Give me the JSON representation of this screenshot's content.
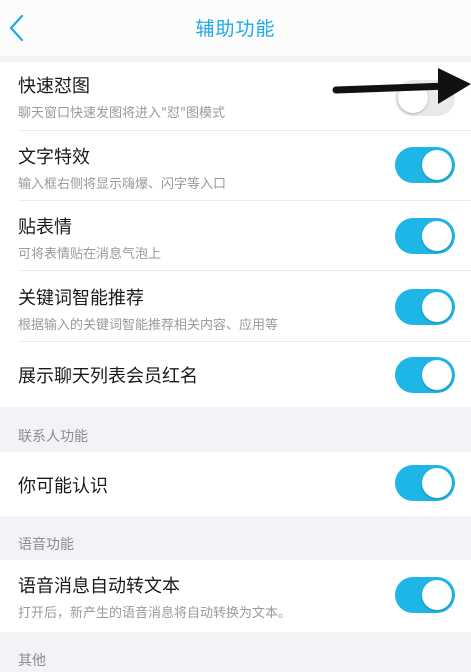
{
  "header": {
    "title": "辅助功能",
    "back_icon": "chevron-left-icon"
  },
  "accent": "#1eb6e6",
  "rows_main": [
    {
      "label": "快速怼图",
      "sub": "聊天窗口快速发图将进入\"怼\"图模式",
      "on": false
    },
    {
      "label": "文字特效",
      "sub": "输入框右侧将显示嗨爆、闪字等入口",
      "on": true
    },
    {
      "label": "贴表情",
      "sub": "可将表情贴在消息气泡上",
      "on": true
    },
    {
      "label": "关键词智能推荐",
      "sub": "根据输入的关键词智能推荐相关内容、应用等",
      "on": true
    },
    {
      "label": "展示聊天列表会员红名",
      "on": true
    }
  ],
  "sections": {
    "contacts": {
      "title": "联系人功能",
      "rows": [
        {
          "label": "你可能认识",
          "on": true
        }
      ]
    },
    "voice": {
      "title": "语音功能",
      "rows": [
        {
          "label": "语音消息自动转文本",
          "sub": "打开后，新产生的语音消息将自动转换为文本。",
          "on": true
        }
      ]
    },
    "other": {
      "title": "其他"
    }
  }
}
